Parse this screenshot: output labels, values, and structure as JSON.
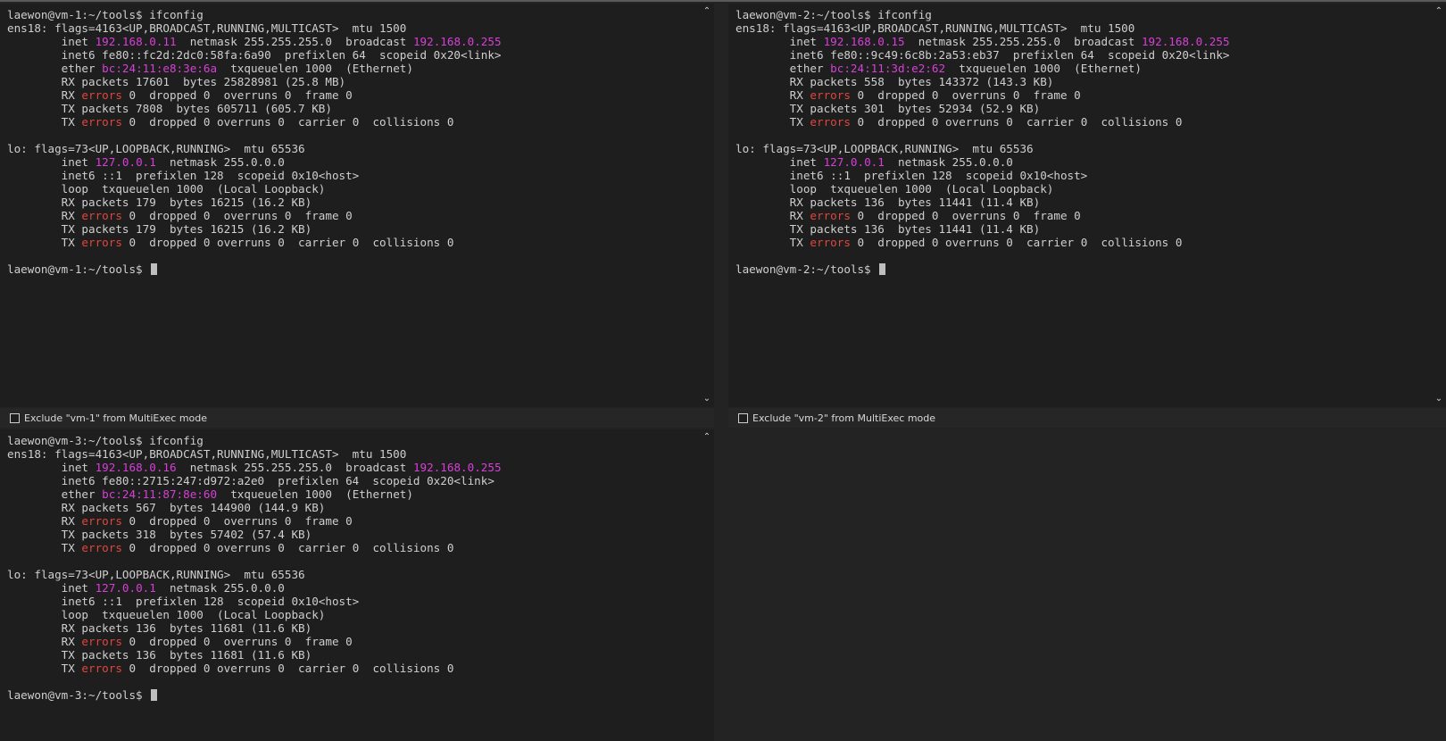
{
  "colors": {
    "background": "#1e1e1e",
    "text": "#cfcfcf",
    "highlight_magenta": "#d83fd8",
    "highlight_red": "#e0463d"
  },
  "panes": [
    {
      "exclude_label": "Exclude \"vm-1\" from MultiExec mode",
      "lines": [
        [
          {
            "t": "laewon@vm-1:~/tools$ ifconfig"
          }
        ],
        [
          {
            "t": "ens18: flags=4163<UP,BROADCAST,RUNNING,MULTICAST>  mtu 1500"
          }
        ],
        [
          {
            "t": "        inet "
          },
          {
            "t": "192.168.0.11",
            "c": "mag"
          },
          {
            "t": "  netmask 255.255.255.0  broadcast "
          },
          {
            "t": "192.168.0.255",
            "c": "mag"
          }
        ],
        [
          {
            "t": "        inet6 fe80::fc2d:2dc0:58fa:6a90  prefixlen 64  scopeid 0x20<link>"
          }
        ],
        [
          {
            "t": "        ether "
          },
          {
            "t": "bc:24:11:e8:3e:6a",
            "c": "mag"
          },
          {
            "t": "  txqueuelen 1000  (Ethernet)"
          }
        ],
        [
          {
            "t": "        RX packets 17601  bytes 25828981 (25.8 MB)"
          }
        ],
        [
          {
            "t": "        RX "
          },
          {
            "t": "errors",
            "c": "red"
          },
          {
            "t": " 0  dropped 0  overruns 0  frame 0"
          }
        ],
        [
          {
            "t": "        TX packets 7808  bytes 605711 (605.7 KB)"
          }
        ],
        [
          {
            "t": "        TX "
          },
          {
            "t": "errors",
            "c": "red"
          },
          {
            "t": " 0  dropped 0 overruns 0  carrier 0  collisions 0"
          }
        ],
        [
          {
            "t": ""
          }
        ],
        [
          {
            "t": "lo: flags=73<UP,LOOPBACK,RUNNING>  mtu 65536"
          }
        ],
        [
          {
            "t": "        inet "
          },
          {
            "t": "127.0.0.1",
            "c": "mag"
          },
          {
            "t": "  netmask 255.0.0.0"
          }
        ],
        [
          {
            "t": "        inet6 ::1  prefixlen 128  scopeid 0x10<host>"
          }
        ],
        [
          {
            "t": "        loop  txqueuelen 1000  (Local Loopback)"
          }
        ],
        [
          {
            "t": "        RX packets 179  bytes 16215 (16.2 KB)"
          }
        ],
        [
          {
            "t": "        RX "
          },
          {
            "t": "errors",
            "c": "red"
          },
          {
            "t": " 0  dropped 0  overruns 0  frame 0"
          }
        ],
        [
          {
            "t": "        TX packets 179  bytes 16215 (16.2 KB)"
          }
        ],
        [
          {
            "t": "        TX "
          },
          {
            "t": "errors",
            "c": "red"
          },
          {
            "t": " 0  dropped 0 overruns 0  carrier 0  collisions 0"
          }
        ],
        [
          {
            "t": ""
          }
        ],
        [
          {
            "t": "laewon@vm-1:~/tools$ "
          },
          {
            "cursor": true
          }
        ]
      ]
    },
    {
      "exclude_label": "Exclude \"vm-2\" from MultiExec mode",
      "lines": [
        [
          {
            "t": "laewon@vm-2:~/tools$ ifconfig"
          }
        ],
        [
          {
            "t": "ens18: flags=4163<UP,BROADCAST,RUNNING,MULTICAST>  mtu 1500"
          }
        ],
        [
          {
            "t": "        inet "
          },
          {
            "t": "192.168.0.15",
            "c": "mag"
          },
          {
            "t": "  netmask 255.255.255.0  broadcast "
          },
          {
            "t": "192.168.0.255",
            "c": "mag"
          }
        ],
        [
          {
            "t": "        inet6 fe80::9c49:6c8b:2a53:eb37  prefixlen 64  scopeid 0x20<link>"
          }
        ],
        [
          {
            "t": "        ether "
          },
          {
            "t": "bc:24:11:3d:e2:62",
            "c": "mag"
          },
          {
            "t": "  txqueuelen 1000  (Ethernet)"
          }
        ],
        [
          {
            "t": "        RX packets 558  bytes 143372 (143.3 KB)"
          }
        ],
        [
          {
            "t": "        RX "
          },
          {
            "t": "errors",
            "c": "red"
          },
          {
            "t": " 0  dropped 0  overruns 0  frame 0"
          }
        ],
        [
          {
            "t": "        TX packets 301  bytes 52934 (52.9 KB)"
          }
        ],
        [
          {
            "t": "        TX "
          },
          {
            "t": "errors",
            "c": "red"
          },
          {
            "t": " 0  dropped 0 overruns 0  carrier 0  collisions 0"
          }
        ],
        [
          {
            "t": ""
          }
        ],
        [
          {
            "t": "lo: flags=73<UP,LOOPBACK,RUNNING>  mtu 65536"
          }
        ],
        [
          {
            "t": "        inet "
          },
          {
            "t": "127.0.0.1",
            "c": "mag"
          },
          {
            "t": "  netmask 255.0.0.0"
          }
        ],
        [
          {
            "t": "        inet6 ::1  prefixlen 128  scopeid 0x10<host>"
          }
        ],
        [
          {
            "t": "        loop  txqueuelen 1000  (Local Loopback)"
          }
        ],
        [
          {
            "t": "        RX packets 136  bytes 11441 (11.4 KB)"
          }
        ],
        [
          {
            "t": "        RX "
          },
          {
            "t": "errors",
            "c": "red"
          },
          {
            "t": " 0  dropped 0  overruns 0  frame 0"
          }
        ],
        [
          {
            "t": "        TX packets 136  bytes 11441 (11.4 KB)"
          }
        ],
        [
          {
            "t": "        TX "
          },
          {
            "t": "errors",
            "c": "red"
          },
          {
            "t": " 0  dropped 0 overruns 0  carrier 0  collisions 0"
          }
        ],
        [
          {
            "t": ""
          }
        ],
        [
          {
            "t": "laewon@vm-2:~/tools$ "
          },
          {
            "cursor": true
          }
        ]
      ]
    },
    {
      "exclude_label": "",
      "lines": [
        [
          {
            "t": "laewon@vm-3:~/tools$ ifconfig"
          }
        ],
        [
          {
            "t": "ens18: flags=4163<UP,BROADCAST,RUNNING,MULTICAST>  mtu 1500"
          }
        ],
        [
          {
            "t": "        inet "
          },
          {
            "t": "192.168.0.16",
            "c": "mag"
          },
          {
            "t": "  netmask 255.255.255.0  broadcast "
          },
          {
            "t": "192.168.0.255",
            "c": "mag"
          }
        ],
        [
          {
            "t": "        inet6 fe80::2715:247:d972:a2e0  prefixlen 64  scopeid 0x20<link>"
          }
        ],
        [
          {
            "t": "        ether "
          },
          {
            "t": "bc:24:11:87:8e:60",
            "c": "mag"
          },
          {
            "t": "  txqueuelen 1000  (Ethernet)"
          }
        ],
        [
          {
            "t": "        RX packets 567  bytes 144900 (144.9 KB)"
          }
        ],
        [
          {
            "t": "        RX "
          },
          {
            "t": "errors",
            "c": "red"
          },
          {
            "t": " 0  dropped 0  overruns 0  frame 0"
          }
        ],
        [
          {
            "t": "        TX packets 318  bytes 57402 (57.4 KB)"
          }
        ],
        [
          {
            "t": "        TX "
          },
          {
            "t": "errors",
            "c": "red"
          },
          {
            "t": " 0  dropped 0 overruns 0  carrier 0  collisions 0"
          }
        ],
        [
          {
            "t": ""
          }
        ],
        [
          {
            "t": "lo: flags=73<UP,LOOPBACK,RUNNING>  mtu 65536"
          }
        ],
        [
          {
            "t": "        inet "
          },
          {
            "t": "127.0.0.1",
            "c": "mag"
          },
          {
            "t": "  netmask 255.0.0.0"
          }
        ],
        [
          {
            "t": "        inet6 ::1  prefixlen 128  scopeid 0x10<host>"
          }
        ],
        [
          {
            "t": "        loop  txqueuelen 1000  (Local Loopback)"
          }
        ],
        [
          {
            "t": "        RX packets 136  bytes 11681 (11.6 KB)"
          }
        ],
        [
          {
            "t": "        RX "
          },
          {
            "t": "errors",
            "c": "red"
          },
          {
            "t": " 0  dropped 0  overruns 0  frame 0"
          }
        ],
        [
          {
            "t": "        TX packets 136  bytes 11681 (11.6 KB)"
          }
        ],
        [
          {
            "t": "        TX "
          },
          {
            "t": "errors",
            "c": "red"
          },
          {
            "t": " 0  dropped 0 overruns 0  carrier 0  collisions 0"
          }
        ],
        [
          {
            "t": ""
          }
        ],
        [
          {
            "t": "laewon@vm-3:~/tools$ "
          },
          {
            "cursor": true
          }
        ]
      ]
    }
  ]
}
